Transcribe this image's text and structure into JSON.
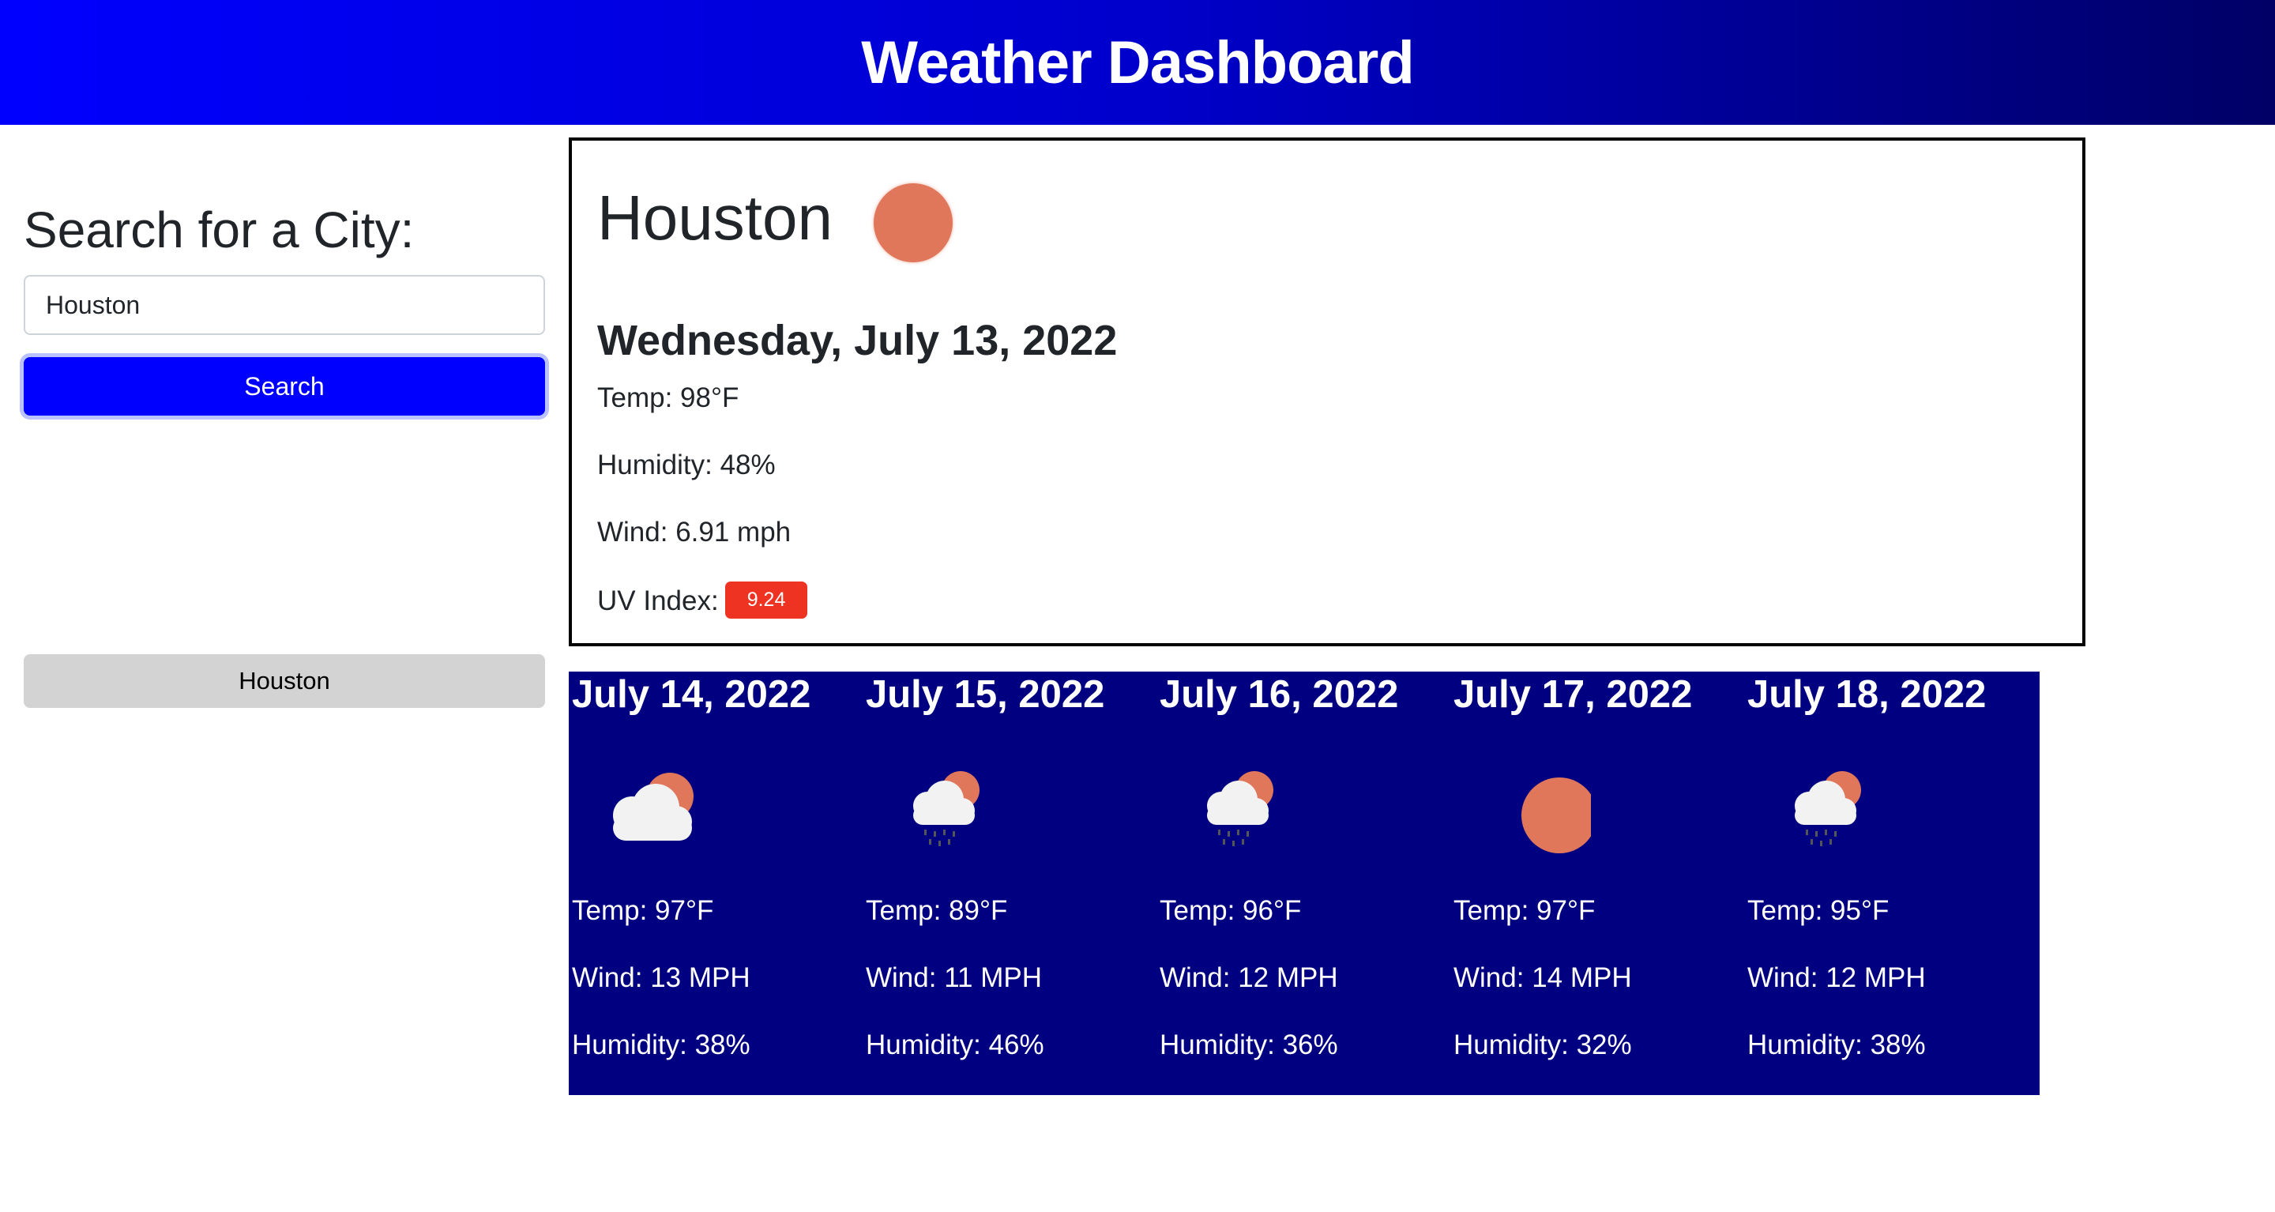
{
  "header": {
    "title": "Weather Dashboard"
  },
  "sidebar": {
    "heading": "Search for a City:",
    "search_value": "Houston",
    "search_button": "Search",
    "history": [
      "Houston"
    ]
  },
  "current": {
    "city": "Houston",
    "icon": "sun-icon",
    "date": "Wednesday, July 13, 2022",
    "temp": "Temp: 98°F",
    "humidity": "Humidity: 48%",
    "wind": "Wind: 6.91 mph",
    "uv_label": "UV Index:",
    "uv_value": "9.24"
  },
  "colors": {
    "header_start": "#0000ff",
    "header_end": "#000066",
    "accent_blue": "#0000ff",
    "forecast_bg": "#000080",
    "uv_high": "#ee3322",
    "sun": "#e0765a"
  },
  "forecast": [
    {
      "date": "July 14, 2022",
      "icon": "cloud-sun-icon",
      "temp": "Temp: 97°F",
      "wind": "Wind: 13 MPH",
      "humidity": "Humidity: 38%"
    },
    {
      "date": "July 15, 2022",
      "icon": "rain-sun-icon",
      "temp": "Temp: 89°F",
      "wind": "Wind: 11 MPH",
      "humidity": "Humidity: 46%"
    },
    {
      "date": "July 16, 2022",
      "icon": "rain-sun-icon",
      "temp": "Temp: 96°F",
      "wind": "Wind: 12 MPH",
      "humidity": "Humidity: 36%"
    },
    {
      "date": "July 17, 2022",
      "icon": "sun-icon",
      "temp": "Temp: 97°F",
      "wind": "Wind: 14 MPH",
      "humidity": "Humidity: 32%"
    },
    {
      "date": "July 18, 2022",
      "icon": "rain-sun-icon",
      "temp": "Temp: 95°F",
      "wind": "Wind: 12 MPH",
      "humidity": "Humidity: 38%"
    }
  ]
}
